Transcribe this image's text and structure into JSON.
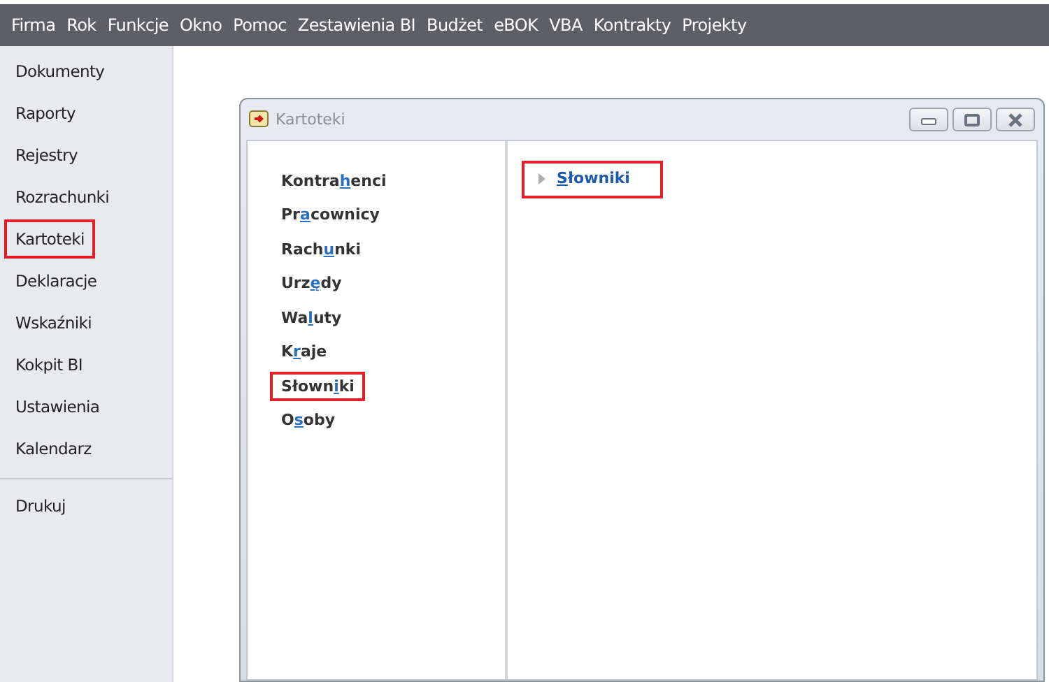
{
  "menu_bar": [
    "Firma",
    "Rok",
    "Funkcje",
    "Okno",
    "Pomoc",
    "Zestawienia BI",
    "Budżet",
    "eBOK",
    "VBA",
    "Kontrakty",
    "Projekty"
  ],
  "sidebar": {
    "groups": [
      [
        {
          "label": "Dokumenty",
          "highlighted": false
        },
        {
          "label": "Raporty",
          "highlighted": false
        },
        {
          "label": "Rejestry",
          "highlighted": false
        },
        {
          "label": "Rozrachunki",
          "highlighted": false
        },
        {
          "label": "Kartoteki",
          "highlighted": true
        },
        {
          "label": "Deklaracje",
          "highlighted": false
        },
        {
          "label": "Wskaźniki",
          "highlighted": false
        },
        {
          "label": "Kokpit BI",
          "highlighted": false
        },
        {
          "label": "Ustawienia",
          "highlighted": false
        },
        {
          "label": "Kalendarz",
          "highlighted": false
        }
      ],
      [
        {
          "label": "Drukuj",
          "highlighted": false
        }
      ]
    ]
  },
  "window": {
    "title": "Kartoteki",
    "list": [
      {
        "before": "Kontra",
        "key": "h",
        "after": "enci",
        "highlighted": false
      },
      {
        "before": "Pr",
        "key": "a",
        "after": "cownicy",
        "highlighted": false
      },
      {
        "before": "Rach",
        "key": "u",
        "after": "nki",
        "highlighted": false
      },
      {
        "before": "Urz",
        "key": "ę",
        "after": "dy",
        "highlighted": false
      },
      {
        "before": "Wa",
        "key": "l",
        "after": "uty",
        "highlighted": false
      },
      {
        "before": "K",
        "key": "r",
        "after": "aje",
        "highlighted": false
      },
      {
        "before": "Słown",
        "key": "i",
        "after": "ki",
        "highlighted": true
      },
      {
        "before": "O",
        "key": "s",
        "after": "oby",
        "highlighted": false
      }
    ],
    "detail": [
      {
        "key": "S",
        "after": "łowniki",
        "highlighted": true
      }
    ]
  }
}
